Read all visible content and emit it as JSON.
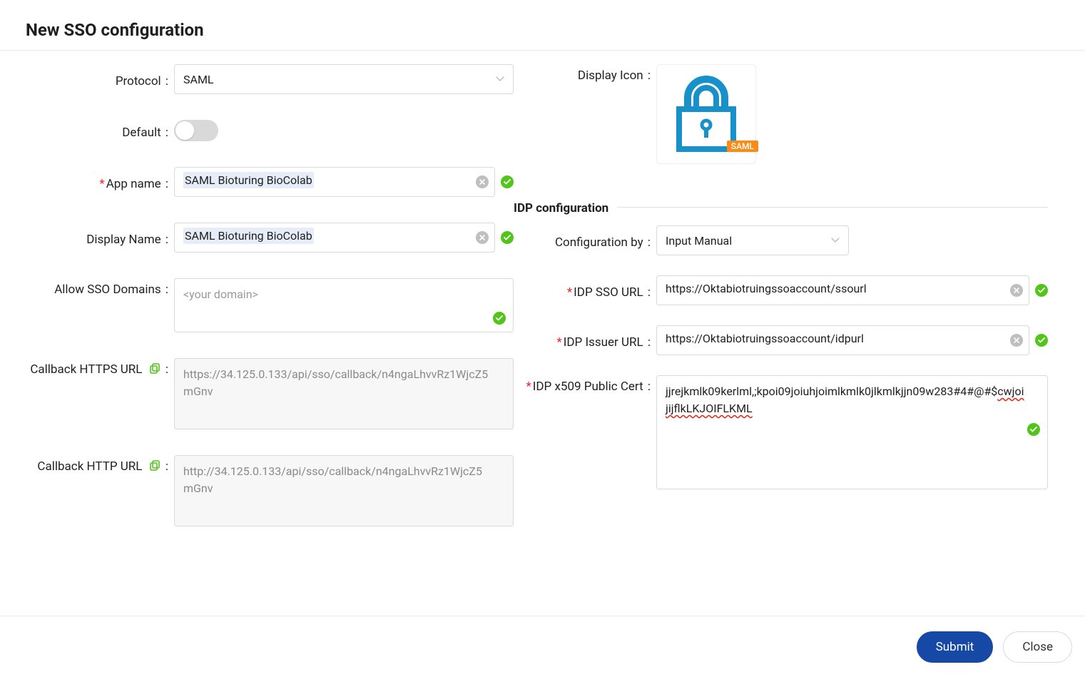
{
  "header": {
    "title": "New SSO configuration"
  },
  "left": {
    "protocol_label": "Protocol",
    "protocol_value": "SAML",
    "default_label": "Default",
    "default_on": false,
    "app_name_label": "App name",
    "app_name_value": "SAML Bioturing BioColab",
    "display_name_label": "Display Name",
    "display_name_value": "SAML Bioturing BioColab",
    "allow_domains_label": "Allow SSO Domains",
    "allow_domains_placeholder": "<your domain>",
    "callback_https_label": "Callback HTTPS URL",
    "callback_https_value": "https://34.125.0.133/api/sso/callback/n4ngaLhvvRz1WjcZ5mGnv",
    "callback_http_label": "Callback HTTP URL",
    "callback_http_value": "http://34.125.0.133/api/sso/callback/n4ngaLhvvRz1WjcZ5mGnv"
  },
  "right": {
    "display_icon_label": "Display Icon",
    "badge": "SAML",
    "idp_heading": "IDP configuration",
    "config_by_label": "Configuration by",
    "config_by_value": "Input Manual",
    "sso_url_label": "IDP SSO URL",
    "sso_url_value": "https://Oktabiotruingssoaccount/ssourl",
    "issuer_url_label": "IDP Issuer URL",
    "issuer_url_value": "https://Oktabiotruingssoaccount/idpurl",
    "cert_label": "IDP x509 Public Cert",
    "cert_value_line1": "jjrejkmlk09kerlml,;kpoi09joiuhjoimlkmlk0jlkmlkjjn09w283#4#@#$",
    "cert_value_spell": "cwjoijijflkLKJOIFLKML"
  },
  "footer": {
    "submit": "Submit",
    "close": "Close"
  }
}
